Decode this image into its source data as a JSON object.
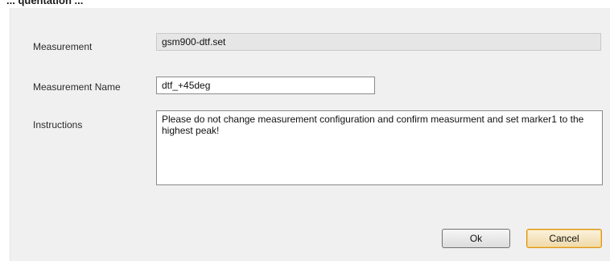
{
  "header_fragment": "... quentation ...",
  "form": {
    "measurement": {
      "label": "Measurement",
      "value": "gsm900-dtf.set"
    },
    "measurement_name": {
      "label": "Measurement Name",
      "value": "dtf_+45deg"
    },
    "instructions": {
      "label": "Instructions",
      "value": "Please do not change measurement configuration and confirm measurment and set marker1 to the highest peak!"
    }
  },
  "buttons": {
    "ok_label": "Ok",
    "cancel_label": "Cancel"
  }
}
